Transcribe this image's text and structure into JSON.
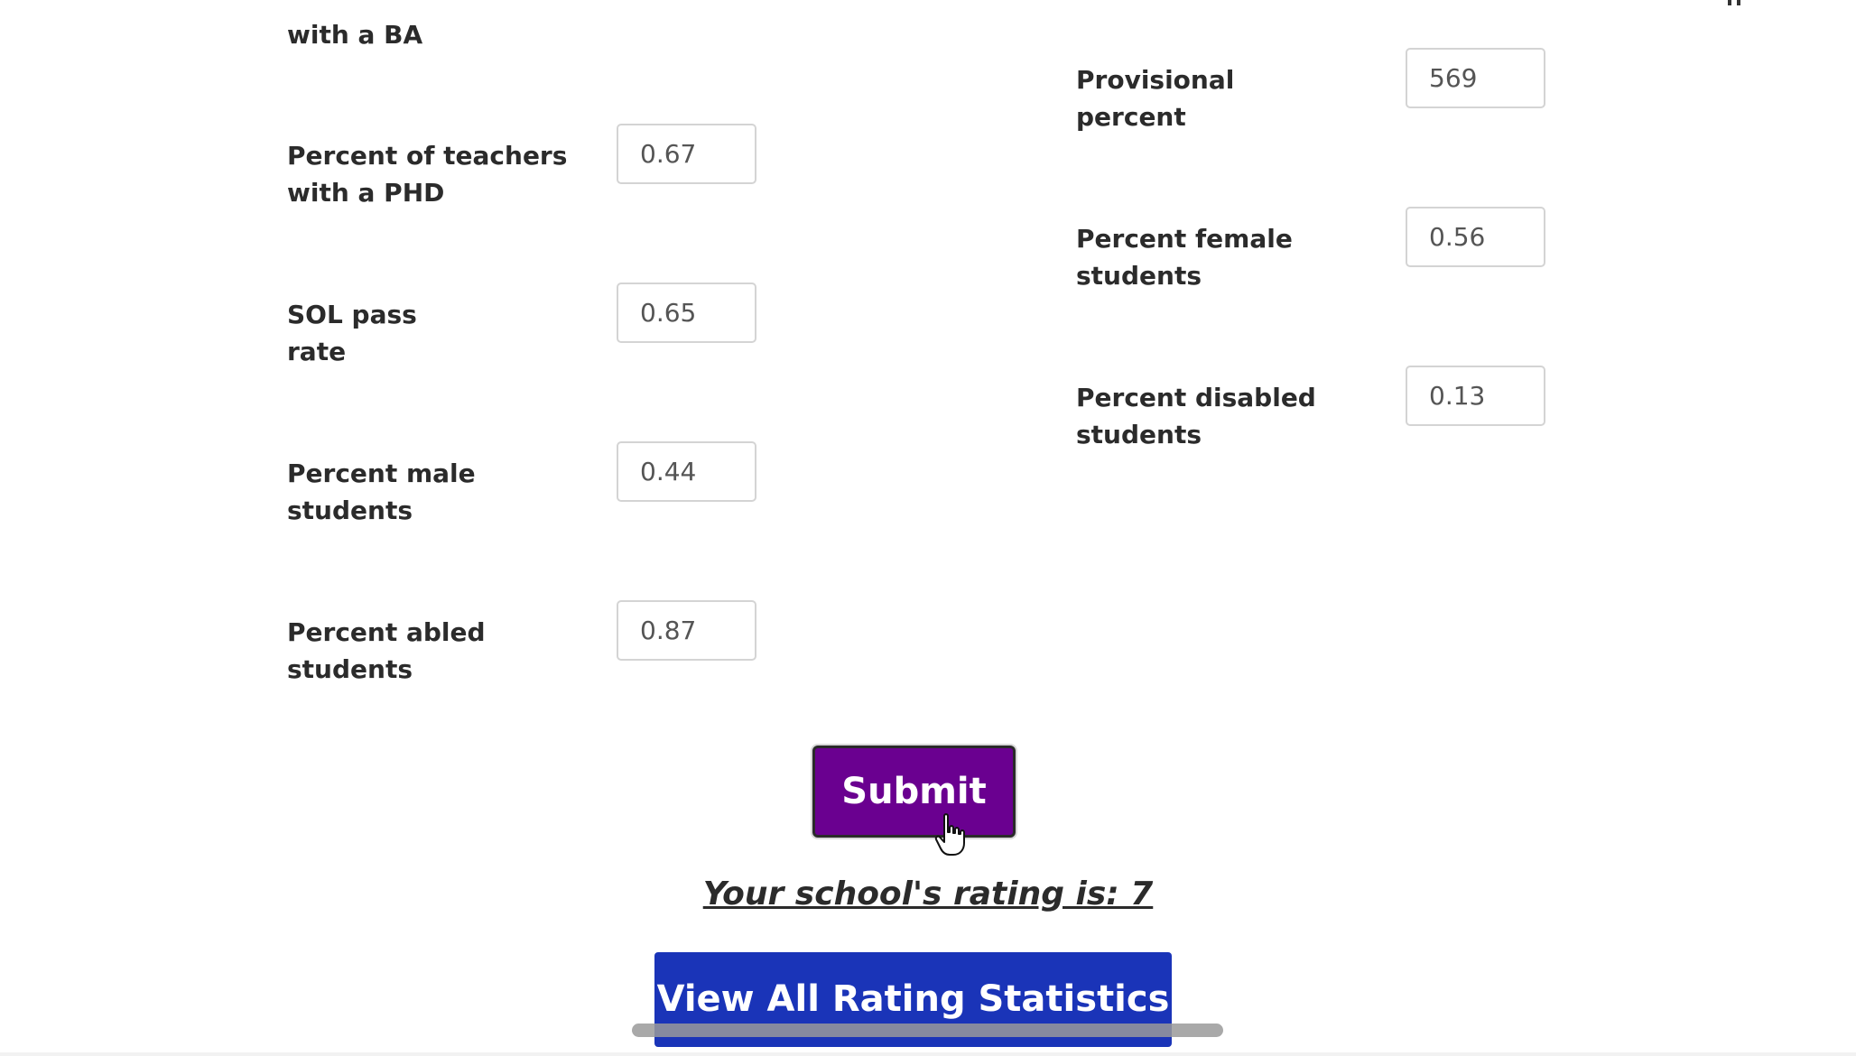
{
  "form": {
    "left": [
      {
        "label": "with a BA",
        "value": ""
      },
      {
        "label": "Percent of teachers\nwith a PHD",
        "value": "0.67"
      },
      {
        "label": "SOL pass\nrate",
        "value": "0.65"
      },
      {
        "label": "Percent male\nstudents",
        "value": "0.44"
      },
      {
        "label": "Percent abled\nstudents",
        "value": "0.87"
      }
    ],
    "right": [
      {
        "label": "Provisional\npercent",
        "value": "569"
      },
      {
        "label": "Percent female\nstudents",
        "value": "0.56"
      },
      {
        "label": "Percent disabled\nstudents",
        "value": "0.13"
      }
    ]
  },
  "submit_label": "Submit",
  "rating_text": "Your school's rating is: 7",
  "stats_button_label": "View All Rating Statistics",
  "colors": {
    "submit_bg": "#6a0090",
    "stats_bg": "#1a34b8"
  },
  "icons": {
    "cursor": "hand-pointer-icon"
  }
}
